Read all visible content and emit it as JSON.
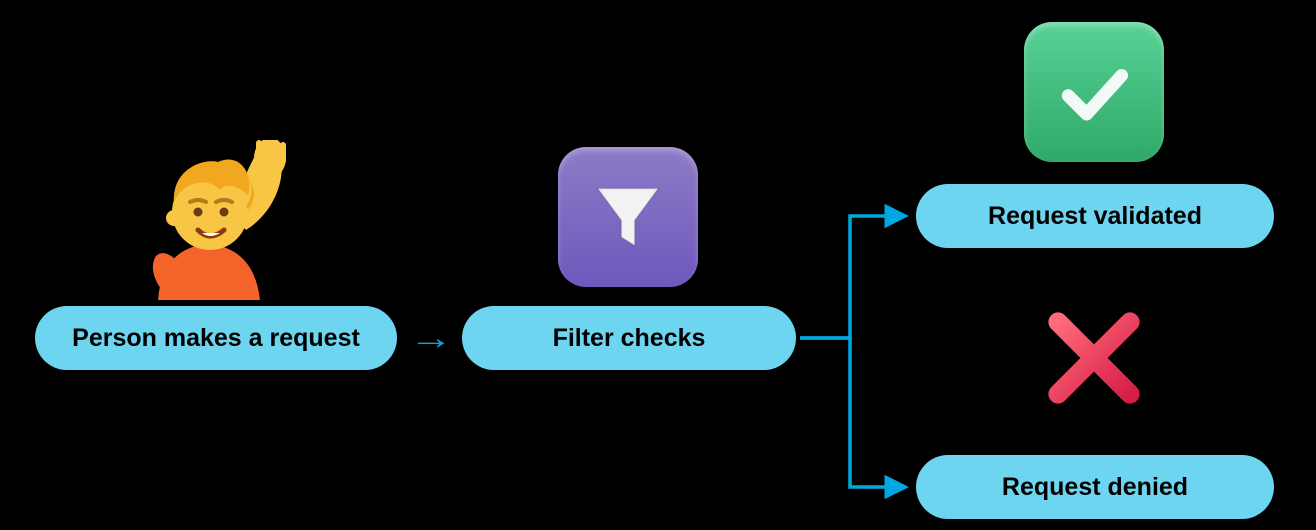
{
  "steps": {
    "request": "Person makes a request",
    "filter": "Filter checks",
    "validated": "Request validated",
    "denied": "Request denied"
  },
  "icons": {
    "person": "person-raising-hand",
    "filter": "filter",
    "check": "checkmark",
    "cross": "cross"
  },
  "colors": {
    "pill": "#6ed5f0",
    "arrow": "#00a7e0",
    "filter_tile": "#6e58bd",
    "check_tile": "#2fa969",
    "cross": "#ec355a"
  }
}
